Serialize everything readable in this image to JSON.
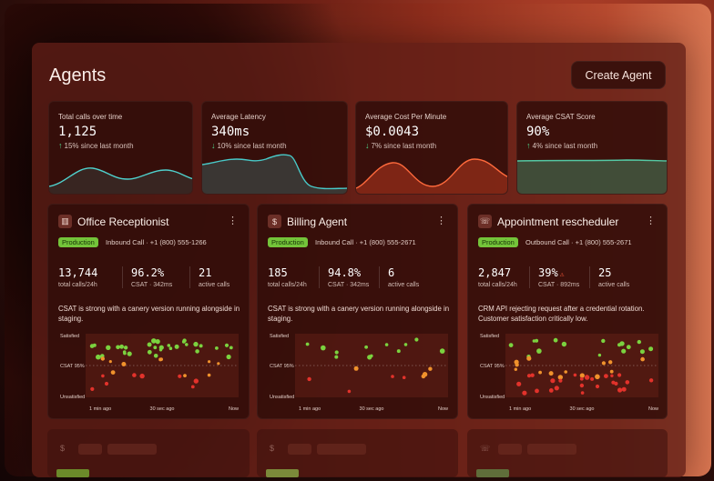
{
  "page": {
    "title": "Agents",
    "create_button": "Create Agent"
  },
  "metrics": [
    {
      "label": "Total calls over time",
      "value": "1,125",
      "delta": "15% since last month",
      "direction": "up",
      "line_color": "#4fd0cc"
    },
    {
      "label": "Average Latency",
      "value": "340ms",
      "delta": "10% since last month",
      "direction": "down",
      "line_color": "#48c9c8"
    },
    {
      "label": "Average Cost Per Minute",
      "value": "$0.0043",
      "delta": "7% since last month",
      "direction": "down",
      "line_color": "#ff6a3c"
    },
    {
      "label": "Average CSAT Score",
      "value": "90%",
      "delta": "4% since last month",
      "direction": "up",
      "line_color": "#54c9a4"
    }
  ],
  "agents": [
    {
      "icon": "building-icon",
      "name": "Office Receptionist",
      "status": "Production",
      "meta": "Inbound Call · +1 (800) 555-1266",
      "stats": [
        {
          "value": "13,744",
          "label": "total calls/24h"
        },
        {
          "value": "96.2%",
          "label": "CSAT · 342ms"
        },
        {
          "value": "21",
          "label": "active calls"
        }
      ],
      "description": "CSAT is strong with a canery version running alongside in staging.",
      "plot": {
        "y_labels": [
          "Satisfied",
          "CSAT 95%",
          "Unsatisfied"
        ],
        "x_labels": [
          "1 min ago",
          "30 sec ago",
          "Now"
        ],
        "threshold": "CSAT 95%"
      }
    },
    {
      "icon": "dollar-icon",
      "name": "Billing Agent",
      "status": "Production",
      "meta": "Inbound Call · +1 (800) 555-2671",
      "stats": [
        {
          "value": "185",
          "label": "total calls/24h"
        },
        {
          "value": "94.8%",
          "label": "CSAT · 342ms"
        },
        {
          "value": "6",
          "label": "active calls"
        }
      ],
      "description": "CSAT is strong with a canery version running alongside in staging.",
      "plot": {
        "y_labels": [
          "Satisfied",
          "CSAT 95%",
          "Unsatisfied"
        ],
        "x_labels": [
          "1 min ago",
          "30 sec ago",
          "Now"
        ],
        "threshold": "CSAT 95%"
      }
    },
    {
      "icon": "phone-call-icon",
      "name": "Appointment rescheduler",
      "status": "Production",
      "meta": "Outbound Call · +1 (800) 555-2671",
      "stats": [
        {
          "value": "2,847",
          "label": "total calls/24h"
        },
        {
          "value": "39%",
          "label": "CSAT · 892ms"
        },
        {
          "value": "25",
          "label": "active calls"
        }
      ],
      "description": "CRM API rejecting request after a credential rotation. Customer satisfaction critically low.",
      "plot": {
        "y_labels": [
          "Satisfied",
          "CSAT 95%",
          "Unsatisfied"
        ],
        "x_labels": [
          "1 min ago",
          "30 sec ago",
          "Now"
        ],
        "threshold": "CSAT 95%"
      }
    }
  ],
  "colors": {
    "green": "#7bd23f",
    "orange": "#f0922c",
    "red": "#e2322b",
    "production_badge": "#74c43a"
  }
}
